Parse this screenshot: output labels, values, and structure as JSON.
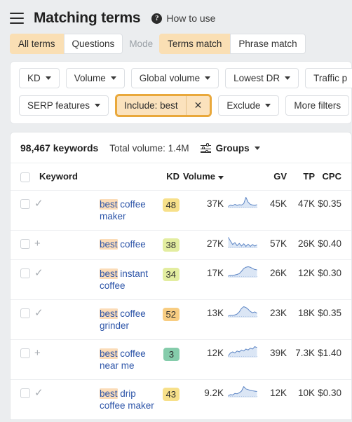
{
  "header": {
    "menu_icon": "hamburger-menu-icon",
    "title": "Matching terms",
    "help_icon": "question-mark-icon",
    "help_label": "How to use"
  },
  "tabs": {
    "terms": [
      {
        "label": "All terms",
        "active": true
      },
      {
        "label": "Questions",
        "active": false
      }
    ],
    "mode_label": "Mode",
    "modes": [
      {
        "label": "Terms match",
        "active": true
      },
      {
        "label": "Phrase match",
        "active": false
      }
    ]
  },
  "filters": {
    "row1": [
      {
        "label": "KD",
        "type": "dropdown"
      },
      {
        "label": "Volume",
        "type": "dropdown"
      },
      {
        "label": "Global volume",
        "type": "dropdown"
      },
      {
        "label": "Lowest DR",
        "type": "dropdown"
      },
      {
        "label": "Traffic p",
        "type": "dropdown"
      }
    ],
    "row2": [
      {
        "label": "SERP features",
        "type": "dropdown"
      }
    ],
    "include_chip": {
      "label": "Include: best",
      "close_icon": "close-x-icon"
    },
    "row2_after": [
      {
        "label": "Exclude",
        "type": "dropdown"
      },
      {
        "label": "More filters",
        "type": "plain"
      }
    ]
  },
  "summary": {
    "keyword_count": "98,467 keywords",
    "total_volume": "Total volume: 1.4M",
    "groups_icon": "sliders-icon",
    "groups_label": "Groups"
  },
  "table": {
    "columns": {
      "keyword": "Keyword",
      "kd": "KD",
      "volume": "Volume",
      "gv": "GV",
      "tp": "TP",
      "cpc": "CPC"
    },
    "sorted_column": "Volume",
    "rows": [
      {
        "action_icon": "checkmark-icon",
        "keyword_highlight": "best",
        "keyword_rest": " coffee maker",
        "kd": "48",
        "kd_color": "#f7e08a",
        "volume": "37K",
        "gv": "45K",
        "tp": "47K",
        "cpc": "$0.35",
        "spark": "8,12,10,14,11,13,12,16,34,20,14,12,11,13"
      },
      {
        "action_icon": "plus-icon",
        "keyword_highlight": "best",
        "keyword_rest": " coffee",
        "kd": "38",
        "kd_color": "#e3eda0",
        "volume": "27K",
        "gv": "57K",
        "tp": "26K",
        "cpc": "$0.40",
        "spark": "34,24,15,20,12,18,11,17,10,16,10,15,11,14"
      },
      {
        "action_icon": "checkmark-icon",
        "keyword_highlight": "best",
        "keyword_rest": " instant coffee",
        "kd": "34",
        "kd_color": "#e3eda0",
        "volume": "17K",
        "gv": "26K",
        "tp": "12K",
        "cpc": "$0.30",
        "spark": "8,9,9,10,11,13,18,24,27,28,27,24,22,21"
      },
      {
        "action_icon": "checkmark-icon",
        "keyword_highlight": "best",
        "keyword_rest": " coffee grinder",
        "kd": "52",
        "kd_color": "#f8cd82",
        "volume": "13K",
        "gv": "23K",
        "tp": "18K",
        "cpc": "$0.35",
        "spark": "7,8,8,9,11,16,24,28,26,22,17,14,16,13"
      },
      {
        "action_icon": "plus-icon",
        "keyword_highlight": "best",
        "keyword_rest": " coffee near me",
        "kd": "3",
        "kd_color": "#85ccab",
        "volume": "12K",
        "gv": "39K",
        "tp": "7.3K",
        "cpc": "$1.40",
        "spark": "14,20,22,20,24,22,26,24,28,26,30,28,33,31"
      },
      {
        "action_icon": "checkmark-icon",
        "keyword_highlight": "best",
        "keyword_rest": " drip coffee maker",
        "kd": "43",
        "kd_color": "#f7e08a",
        "volume": "9.2K",
        "gv": "12K",
        "tp": "10K",
        "cpc": "$0.30",
        "spark": "6,9,8,12,11,14,18,30,24,22,20,19,18,17"
      }
    ]
  },
  "colors": {
    "accent": "#e9a83b",
    "link": "#2c54a8",
    "highlight": "#fbdcb8",
    "active_tab": "#fadfb4",
    "page_bg": "#ebedef"
  }
}
